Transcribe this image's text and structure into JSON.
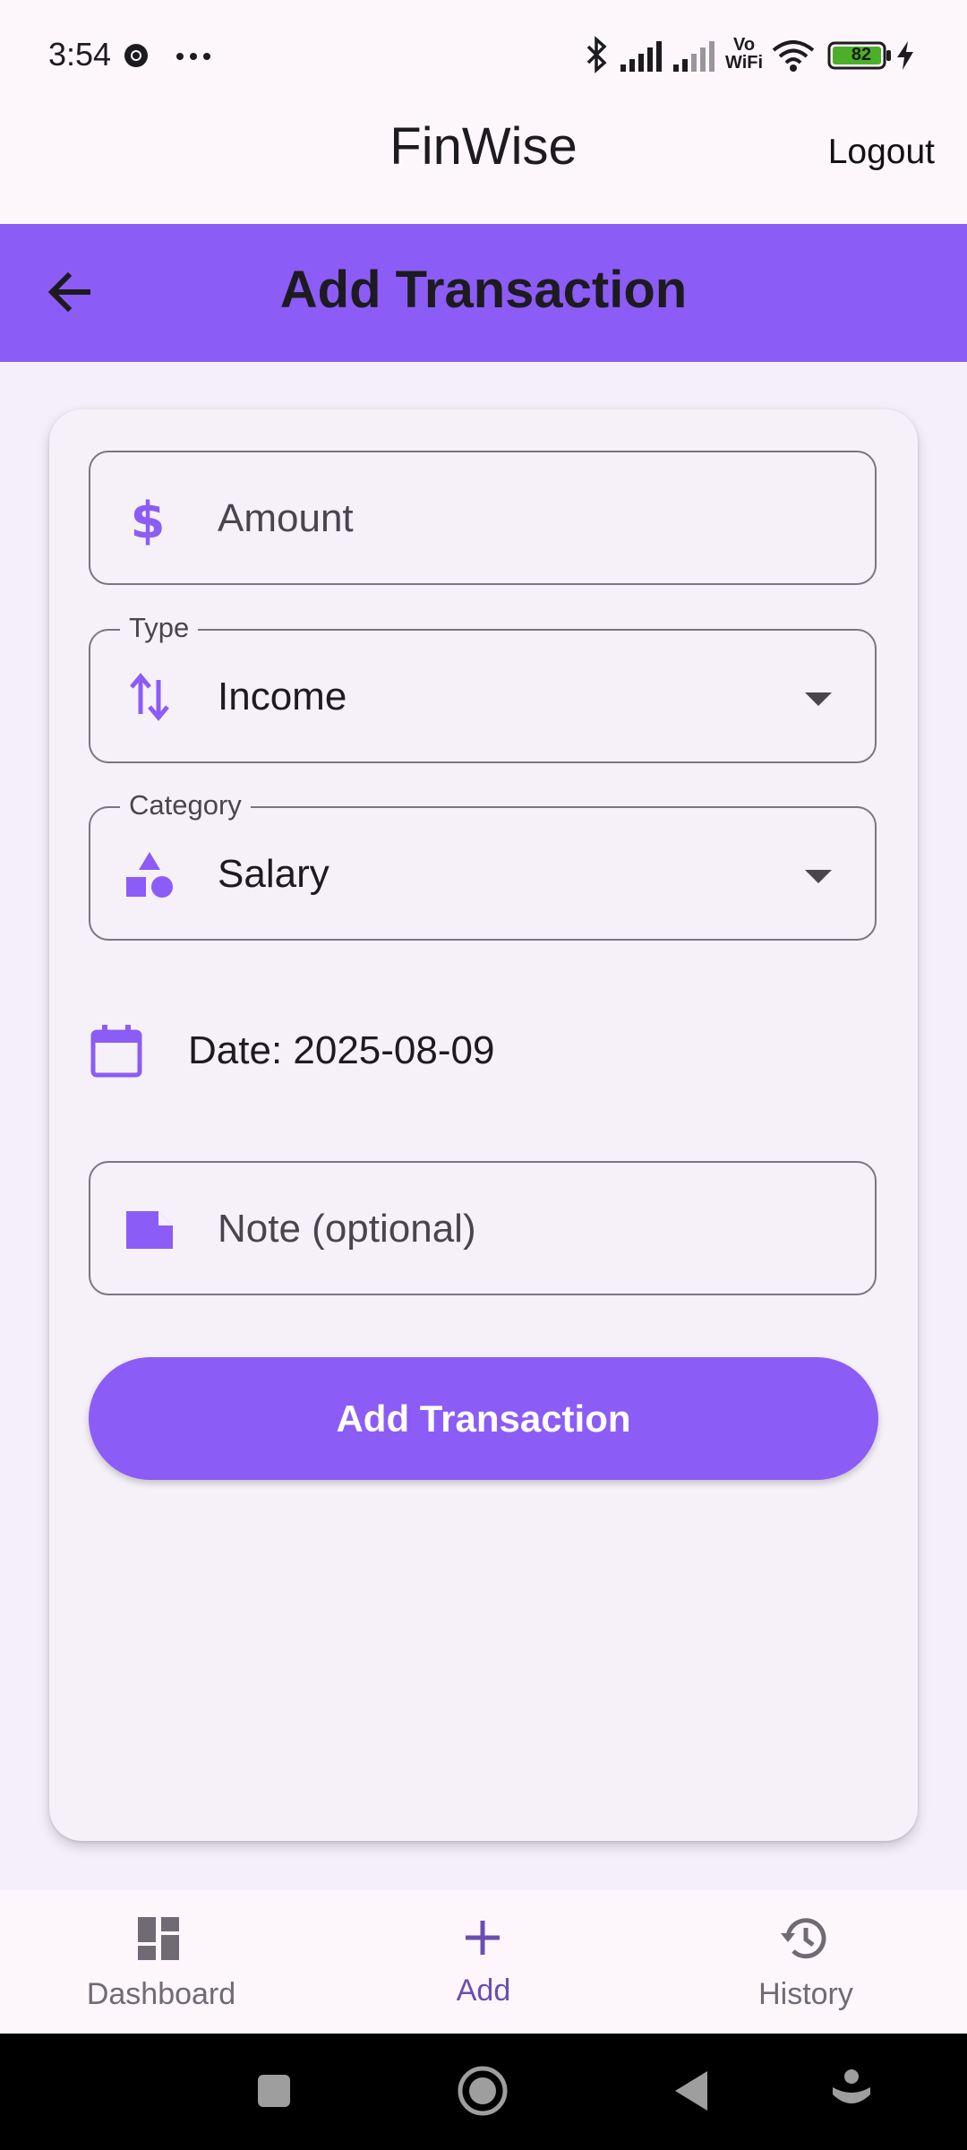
{
  "status_bar": {
    "time": "3:54",
    "battery_level": "82",
    "icons": [
      "chrome-icon",
      "more-dots-icon",
      "bluetooth-icon",
      "signal-icon",
      "signal-weak-icon",
      "vowifi-icon",
      "wifi-icon",
      "battery-icon",
      "charging-icon"
    ],
    "vowifi_top": "Vo",
    "vowifi_bottom": "WiFi"
  },
  "header": {
    "app_title": "FinWise",
    "logout_label": "Logout"
  },
  "page_bar": {
    "title": "Add Transaction",
    "back_icon": "arrow-back-icon"
  },
  "form": {
    "amount": {
      "placeholder": "Amount",
      "icon": "dollar-icon"
    },
    "type": {
      "label": "Type",
      "value": "Income",
      "icon": "swap-vertical-icon"
    },
    "category": {
      "label": "Category",
      "value": "Salary",
      "icon": "category-shapes-icon"
    },
    "date": {
      "text": "Date: 2025-08-09",
      "icon": "calendar-icon"
    },
    "note": {
      "placeholder": "Note (optional)",
      "icon": "note-icon"
    },
    "submit_label": "Add Transaction"
  },
  "bottom_nav": {
    "items": [
      {
        "label": "Dashboard",
        "icon": "dashboard-icon",
        "active": false
      },
      {
        "label": "Add",
        "icon": "plus-icon",
        "active": true
      },
      {
        "label": "History",
        "icon": "history-icon",
        "active": false
      }
    ]
  },
  "system_nav": [
    "recents-square-icon",
    "home-circle-icon",
    "back-triangle-icon",
    "assistant-icon"
  ],
  "colors": {
    "accent": "#8c5cf6",
    "background": "#fdf7fc",
    "card": "#f6f1f8",
    "nav_active": "#6a4fb0"
  }
}
